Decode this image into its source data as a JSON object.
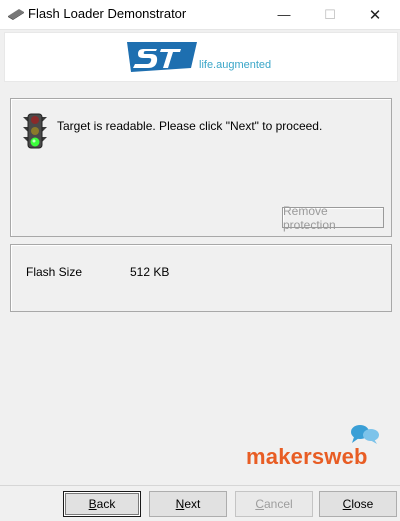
{
  "window": {
    "title": "Flash Loader Demonstrator",
    "minimize_glyph": "—",
    "maximize_glyph": "☐",
    "close_glyph": "✕"
  },
  "banner": {
    "logo_icon": "st-logo",
    "tagline": "life.augmented",
    "accent_color": "#3aa6c8"
  },
  "status": {
    "icon": "traffic-light-green-icon",
    "message": "Target is readable. Please click \"Next\" to proceed.",
    "remove_protection_label": "Remove protection"
  },
  "info": {
    "flash_size_label": "Flash Size",
    "flash_size_value": "512 KB"
  },
  "watermark": {
    "text": "makersweb",
    "color": "#e85d24"
  },
  "buttons": {
    "back_first": "B",
    "back_rest": "ack",
    "next_first": "N",
    "next_rest": "ext",
    "cancel_first": "C",
    "cancel_rest": "ancel",
    "close_first": "C",
    "close_rest": "lose"
  }
}
